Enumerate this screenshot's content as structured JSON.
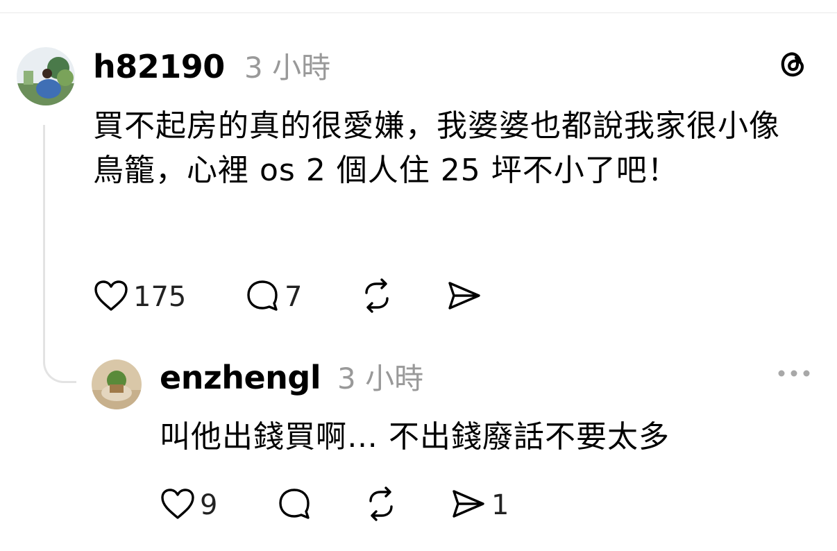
{
  "comments": [
    {
      "username": "h82190",
      "time": "3 小時",
      "text": "買不起房的真的很愛嫌，我婆婆也都說我家很小像鳥籠，心裡 os 2 個人住 25 坪不小了吧！",
      "likes": "175",
      "replies": "7",
      "repost_icon": "repost-icon",
      "share_icon": "share-icon",
      "avatar_icon": "avatar-photo"
    },
    {
      "username": "enzhengl",
      "time": "3 小時",
      "text": "叫他出錢買啊… 不出錢廢話不要太多",
      "likes": "9",
      "shares": "1",
      "avatar_icon": "avatar-photo"
    }
  ],
  "header_icon": "threads-logo-icon",
  "menu_icon": "more-icon"
}
